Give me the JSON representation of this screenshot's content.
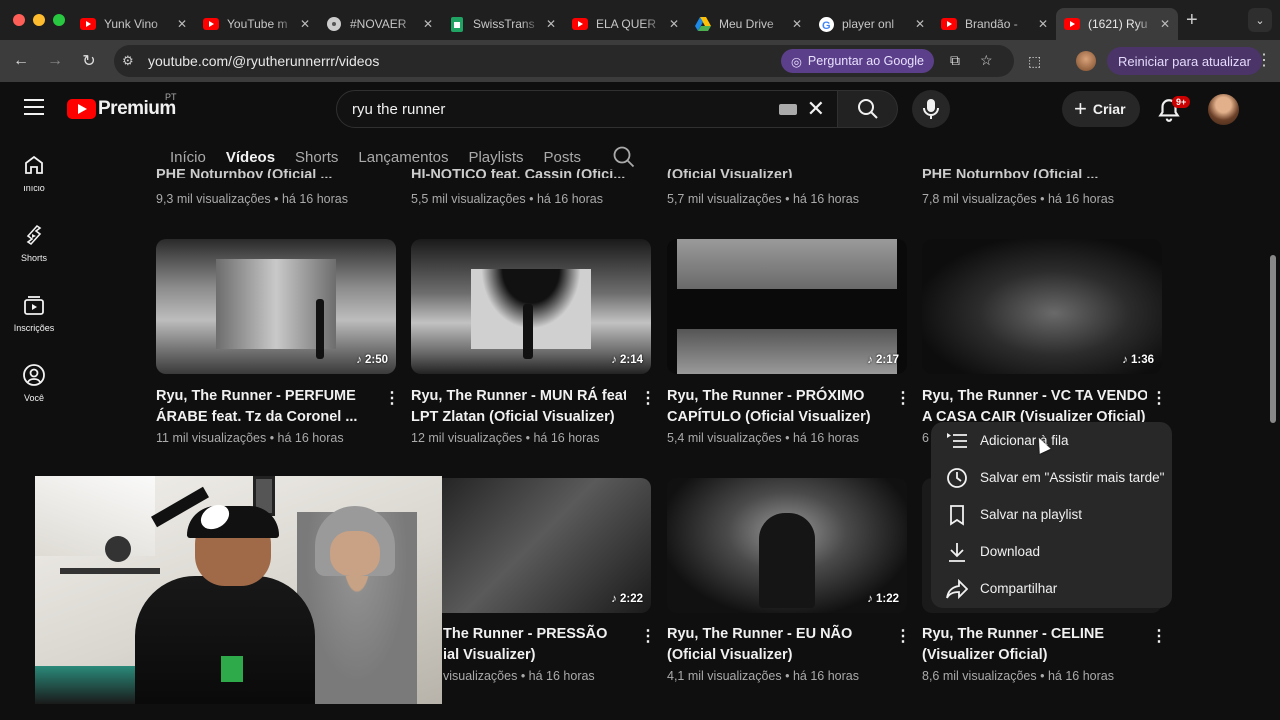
{
  "browser": {
    "tabs": [
      {
        "title": "Yunk Vino",
        "icon": "youtube-icon"
      },
      {
        "title": "YouTube m",
        "icon": "youtube-icon"
      },
      {
        "title": "#NOVAER",
        "icon": "disc-icon"
      },
      {
        "title": "SwissTrans",
        "icon": "sheets-icon"
      },
      {
        "title": "ELA QUER",
        "icon": "youtube-icon"
      },
      {
        "title": "Meu Drive",
        "icon": "drive-icon"
      },
      {
        "title": "player onl",
        "icon": "google-icon"
      },
      {
        "title": "Brandão -",
        "icon": "youtube-icon"
      },
      {
        "title": "(1621) Ryu",
        "icon": "youtube-icon"
      }
    ],
    "url": "youtube.com/@ryutherunnerrr/videos",
    "ask_google": "Perguntar ao Google",
    "restart": "Reiniciar para atualizar"
  },
  "youtube": {
    "logo_text": "Premium",
    "country": "PT",
    "search_value": "ryu the runner",
    "create_label": "Criar",
    "notif_badge": "9+"
  },
  "sidebar": [
    {
      "label": "Início",
      "icon": "home-icon"
    },
    {
      "label": "Shorts",
      "icon": "shorts-icon"
    },
    {
      "label": "Inscrições",
      "icon": "subscriptions-icon"
    },
    {
      "label": "Você",
      "icon": "you-icon"
    }
  ],
  "channel_tabs": [
    "Início",
    "Vídeos",
    "Shorts",
    "Lançamentos",
    "Playlists",
    "Posts"
  ],
  "top_row_meta": [
    "9,3 mil visualizações • há 16 horas",
    "5,5 mil visualizações • há 16 horas",
    "5,7 mil visualizações • há 16 horas",
    "7,8 mil visualizações • há 16 horas"
  ],
  "top_row_titles": [
    "PHE Noturnboy (Oficial ...",
    "HI-NOTICO feat. Cassin (Ofici...",
    "(Oficial Visualizer)",
    "PHE Noturnboy (Oficial ..."
  ],
  "videos_row1": [
    {
      "title1": "Ryu, The Runner - PERFUME",
      "title2": "ÁRABE feat. Tz da Coronel ...",
      "meta": "11 mil visualizações • há 16 horas",
      "duration": "2:50"
    },
    {
      "title1": "Ryu, The Runner - MUN RÁ feat.",
      "title2": "LPT Zlatan (Oficial Visualizer)",
      "meta": "12 mil visualizações • há 16 horas",
      "duration": "2:14"
    },
    {
      "title1": "Ryu, The Runner - PRÓXIMO",
      "title2": "CAPÍTULO (Oficial Visualizer)",
      "meta": "5,4 mil visualizações • há 16 horas",
      "duration": "2:17"
    },
    {
      "title1": "Ryu, The Runner - VC TA VENDO",
      "title2": "A CASA CAIR (Visualizer Oficial)",
      "meta": "6",
      "duration": "1:36"
    }
  ],
  "videos_row2": [
    {
      "title1": "The Runner - PRESSÃO",
      "title2": "ial Visualizer)",
      "meta": "visualizações • há 16 horas",
      "duration": "2:22"
    },
    {
      "title1": "Ryu, The Runner - EU NÃO",
      "title2": "(Oficial Visualizer)",
      "meta": "4,1 mil visualizações • há 16 horas",
      "duration": "1:22"
    },
    {
      "title1": "Ryu, The Runner - CELINE",
      "title2": "(Visualizer Oficial)",
      "meta": "8,6 mil visualizações • há 16 horas",
      "duration": ""
    }
  ],
  "context_menu": [
    {
      "label": "Adicionar à fila",
      "icon": "queue-icon"
    },
    {
      "label": "Salvar em \"Assistir mais tarde\"",
      "icon": "clock-icon"
    },
    {
      "label": "Salvar na playlist",
      "icon": "bookmark-icon"
    },
    {
      "label": "Download",
      "icon": "download-icon"
    },
    {
      "label": "Compartilhar",
      "icon": "share-icon"
    }
  ]
}
